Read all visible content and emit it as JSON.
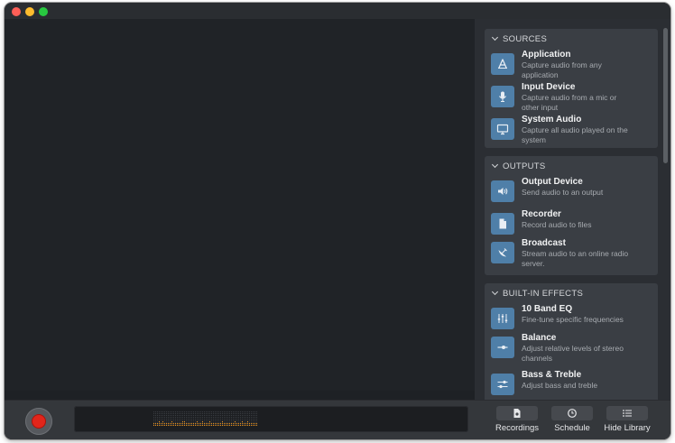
{
  "window": {
    "controls": [
      "close",
      "minimize",
      "zoom"
    ]
  },
  "sidebar": {
    "sections": [
      {
        "title": "SOURCES",
        "items": [
          {
            "name": "Application",
            "desc": "Capture audio from any application",
            "icon": "app-store-icon"
          },
          {
            "name": "Input Device",
            "desc": "Capture audio from a mic or other input",
            "icon": "microphone-icon"
          },
          {
            "name": "System Audio",
            "desc": "Capture all audio played on the system",
            "icon": "monitor-icon"
          }
        ]
      },
      {
        "title": "OUTPUTS",
        "items": [
          {
            "name": "Output Device",
            "desc": "Send audio to an output",
            "icon": "speaker-icon"
          },
          {
            "name": "Recorder",
            "desc": "Record audio to files",
            "icon": "file-icon"
          },
          {
            "name": "Broadcast",
            "desc": "Stream audio to an online radio server.",
            "icon": "satellite-dish-icon"
          }
        ]
      },
      {
        "title": "BUILT-IN EFFECTS",
        "items": [
          {
            "name": "10 Band EQ",
            "desc": "Fine-tune specific frequencies",
            "icon": "equalizer-icon"
          },
          {
            "name": "Balance",
            "desc": "Adjust relative levels of stereo channels",
            "icon": "balance-slider-icon"
          },
          {
            "name": "Bass & Treble",
            "desc": "Adjust bass and treble",
            "icon": "bass-treble-icon"
          }
        ]
      }
    ]
  },
  "toolbar": {
    "record": {
      "icon": "record-icon"
    },
    "recordings_label": "Recordings",
    "schedule_label": "Schedule",
    "hide_library_label": "Hide Library"
  },
  "colors": {
    "accent_icon_bg": "#4f7fa8",
    "record_red": "#e1251b",
    "meter_orange": "#e8901a"
  }
}
